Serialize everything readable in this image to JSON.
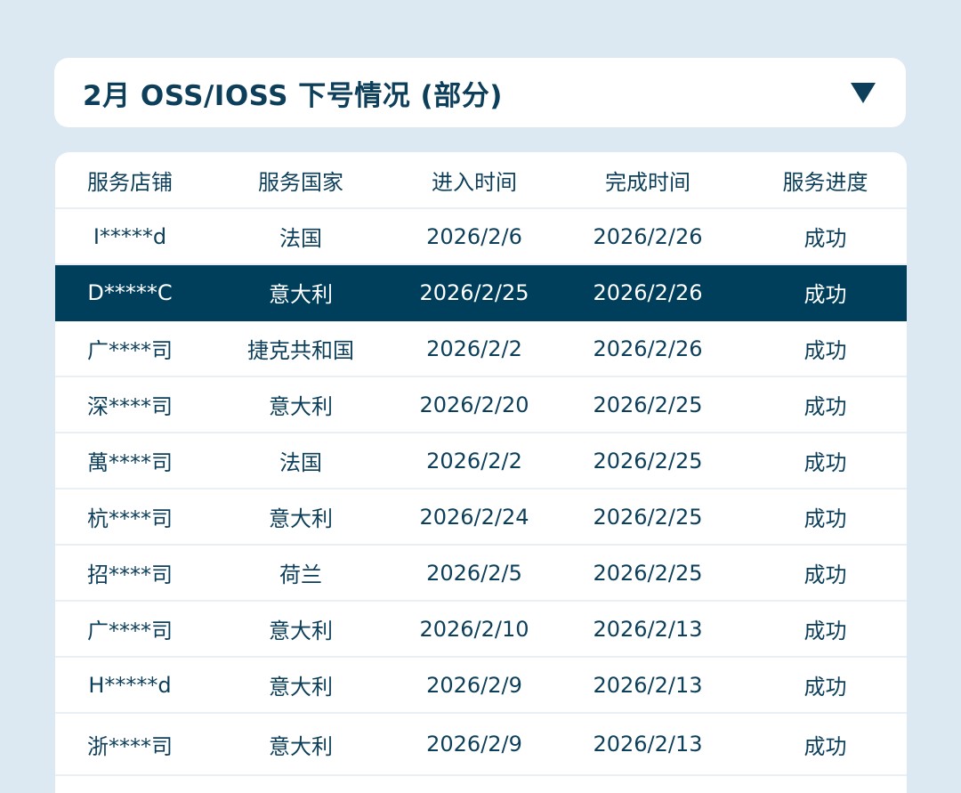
{
  "header": {
    "title": "2月 OSS/IOSS 下号情况 (部分)"
  },
  "table": {
    "columns": [
      "服务店铺",
      "服务国家",
      "进入时间",
      "完成时间",
      "服务进度"
    ],
    "rows": [
      {
        "store": "I*****d",
        "country": "法国",
        "entry": "2026/2/6",
        "done": "2026/2/26",
        "status": "成功"
      },
      {
        "store": "D*****C",
        "country": "意大利",
        "entry": "2026/2/25",
        "done": "2026/2/26",
        "status": "成功"
      },
      {
        "store": "广****司",
        "country": "捷克共和国",
        "entry": "2026/2/2",
        "done": "2026/2/26",
        "status": "成功"
      },
      {
        "store": "深****司",
        "country": "意大利",
        "entry": "2026/2/20",
        "done": "2026/2/25",
        "status": "成功"
      },
      {
        "store": "萬****司",
        "country": "法国",
        "entry": "2026/2/2",
        "done": "2026/2/25",
        "status": "成功"
      },
      {
        "store": "杭****司",
        "country": "意大利",
        "entry": "2026/2/24",
        "done": "2026/2/25",
        "status": "成功"
      },
      {
        "store": "招****司",
        "country": "荷兰",
        "entry": "2026/2/5",
        "done": "2026/2/25",
        "status": "成功"
      },
      {
        "store": "广****司",
        "country": "意大利",
        "entry": "2026/2/10",
        "done": "2026/2/13",
        "status": "成功"
      },
      {
        "store": "H*****d",
        "country": "意大利",
        "entry": "2026/2/9",
        "done": "2026/2/13",
        "status": "成功"
      },
      {
        "store": "浙****司",
        "country": "意大利",
        "entry": "2026/2/9",
        "done": "2026/2/13",
        "status": "成功"
      }
    ]
  },
  "colors": {
    "background": "#dce9f2",
    "text": "#0d3f5a",
    "highlight_row": "#003f5c"
  }
}
